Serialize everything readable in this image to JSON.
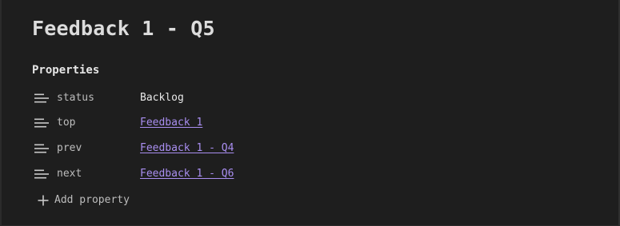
{
  "page": {
    "title": "Feedback 1 - Q5"
  },
  "properties": {
    "heading": "Properties",
    "items": [
      {
        "key": "status",
        "value": "Backlog",
        "icon": "text-lines-icon",
        "is_link": false
      },
      {
        "key": "top",
        "value": "Feedback 1",
        "icon": "text-lines-icon",
        "is_link": true
      },
      {
        "key": "prev",
        "value": "Feedback 1 - Q4",
        "icon": "text-lines-icon",
        "is_link": true
      },
      {
        "key": "next",
        "value": "Feedback 1 - Q6",
        "icon": "text-lines-icon",
        "is_link": true
      }
    ],
    "add_label": "Add property",
    "add_icon": "plus-icon"
  },
  "colors": {
    "background": "#1e1e1e",
    "text": "#dcdcdc",
    "muted": "#bdbdbd",
    "link": "#a98ef0"
  }
}
